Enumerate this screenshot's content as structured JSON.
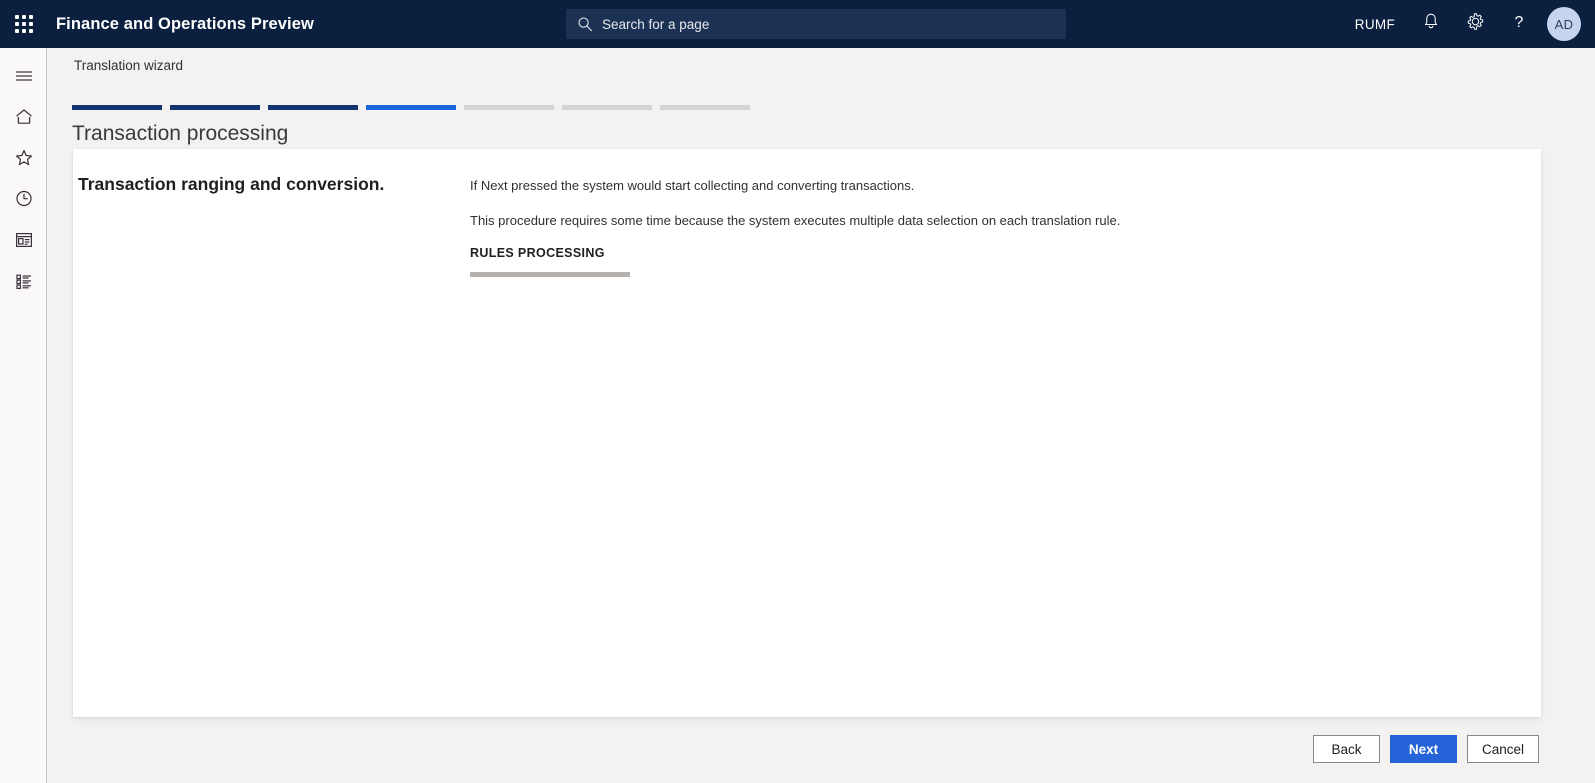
{
  "topbar": {
    "waffle_icon": "app-launcher-icon",
    "app_title": "Finance and Operations Preview",
    "search": {
      "icon": "search-icon",
      "placeholder": "Search for a page",
      "value": ""
    },
    "company": "RUMF",
    "icons": [
      {
        "name": "notifications-icon",
        "glyph": "bell"
      },
      {
        "name": "settings-icon",
        "glyph": "gear"
      },
      {
        "name": "help-icon",
        "glyph": "question"
      }
    ],
    "avatar_initials": "AD"
  },
  "sidebar": {
    "items": [
      {
        "name": "menu-toggle",
        "icon": "hamburger-icon",
        "label": "Expand the navigation pane"
      },
      {
        "name": "home",
        "icon": "home-icon",
        "label": "Home"
      },
      {
        "name": "favorites",
        "icon": "star-icon",
        "label": "Favorites"
      },
      {
        "name": "recent",
        "icon": "clock-icon",
        "label": "Recent"
      },
      {
        "name": "workspaces",
        "icon": "workspace-icon",
        "label": "Workspaces"
      },
      {
        "name": "modules",
        "icon": "list-icon",
        "label": "Modules"
      }
    ]
  },
  "page": {
    "breadcrumb": "Translation wizard",
    "title": "Transaction processing",
    "steps": [
      {
        "state": "done"
      },
      {
        "state": "done"
      },
      {
        "state": "done"
      },
      {
        "state": "current"
      },
      {
        "state": "todo"
      },
      {
        "state": "todo"
      },
      {
        "state": "todo"
      }
    ]
  },
  "card": {
    "heading": "Transaction ranging and conversion.",
    "lines": [
      "If Next pressed the system would start collecting and converting transactions.",
      "This procedure requires some time because the system executes multiple data selection on each translation rule."
    ],
    "progress_label": "RULES PROCESSING",
    "progress_percent": ""
  },
  "footer": {
    "back_label": "Back",
    "next_label": "Next",
    "cancel_label": "Cancel"
  },
  "colors": {
    "topbar_bg": "#0b1f3f",
    "search_bg": "#1b3254",
    "accent_primary": "#2463d8",
    "step_done": "#123471",
    "step_current": "#1766da",
    "step_todo": "#d6d4d2",
    "canvas_bg": "#f3f2f1",
    "card_bg": "#ffffff"
  }
}
